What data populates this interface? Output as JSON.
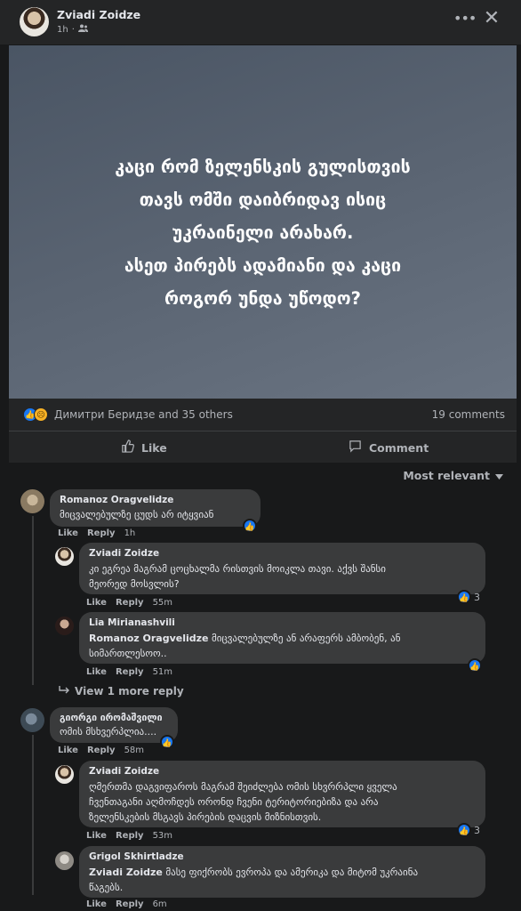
{
  "post": {
    "author": "Zviadi Zoidze",
    "time": "1h",
    "text": "კაცი რომ ზელენსკის გულისთვის\nთავს ომში დაიბრიდავ ისიც\nუკრაინელი არახარ.\nასეთ პირებს ადამიანი და კაცი\nროგორ უნდა უწოდო?",
    "reactions_text": "Димитри Беридзе and 35 others",
    "comments_count": "19 comments",
    "like_label": "Like",
    "comment_label": "Comment",
    "sort_label": "Most relevant",
    "bg_color": "#5a6472"
  },
  "comments": [
    {
      "author": "Romanoz Oragvelidze",
      "text": "მიცვალებულზე ცუდს არ იტყვიან",
      "like": "Like",
      "reply": "Reply",
      "time": "1h"
    },
    {
      "author": "Zviadi Zoidze",
      "text_l1": "კი ეგრეა მაგრამ ცოცხალმა რისთვის მოიკლა თავი. აქვს შანსი",
      "text_l2": "მეორედ მოსვლის?",
      "like": "Like",
      "reply": "Reply",
      "time": "55m",
      "react_count": "3"
    },
    {
      "author": "Lia Mirianashvili",
      "tag": "Romanoz Oragvelidze",
      "text_l1": " მიცვალებულზე ან არაფერს ამბობენ, ან",
      "text_l2": "სიმართლესოო..",
      "like": "Like",
      "reply": "Reply",
      "time": "51m"
    },
    {
      "view_more": "View 1 more reply"
    },
    {
      "author": "გიორგი ირომაშვილი",
      "text": "ომის მსხვერპლია....",
      "like": "Like",
      "reply": "Reply",
      "time": "58m"
    },
    {
      "author": "Zviadi Zoidze",
      "text_l1": "ღმერთმა დაგვიფაროს მაგრამ შეიძლება ომის სხვრრპლი ყველა",
      "text_l2": "ჩვენთაგანი აღმოჩდეს ორონდ ჩვენი ტერიტორიებიზა და არა",
      "text_l3": "ზელენსკების მსგავს პირების დაცვის მიზნისთვის.",
      "like": "Like",
      "reply": "Reply",
      "time": "53m",
      "react_count": "3"
    },
    {
      "author": "Grigol Skhirtladze",
      "tag": "Zviadi Zoidze",
      "text_l1": " მასე ფიქრობს ევროპა და ამერიკა და მიტომ უკრაინა",
      "text_l2": "წაგებს.",
      "like": "Like",
      "reply": "Reply",
      "time": "6m"
    }
  ],
  "icons": {
    "more": "more-options-icon",
    "close": "close-icon",
    "audience": "friends-icon",
    "like": "thumbs-up-icon",
    "comment": "comment-icon",
    "sad": "sad-reaction-icon",
    "chevron": "chevron-down-icon",
    "reply_arrow": "reply-arrow-icon"
  },
  "colors": {
    "background": "#18191a",
    "surface": "#242526",
    "bubble": "#3a3b3c",
    "accent": "#1877f2"
  }
}
